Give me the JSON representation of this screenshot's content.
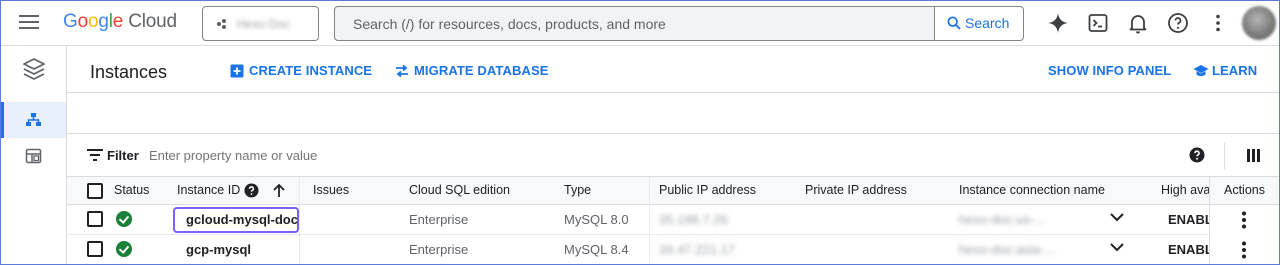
{
  "topbar": {
    "brand": {
      "google": "Google",
      "cloud": "Cloud"
    },
    "project_name": "Hexo Doc",
    "search": {
      "placeholder": "Search (/) for resources, docs, products, and more",
      "button_label": "Search"
    },
    "icons": [
      "gemini-sparkle-icon",
      "cloud-shell-icon",
      "notifications-icon",
      "help-icon",
      "more-vert-icon"
    ]
  },
  "rail": {
    "product_icon": "sql-stack-icon",
    "items": [
      {
        "name": "instances-nav-icon",
        "active": true
      },
      {
        "name": "overview-nav-icon",
        "active": false
      }
    ]
  },
  "header": {
    "title": "Instances",
    "create_label": "CREATE INSTANCE",
    "migrate_label": "MIGRATE DATABASE",
    "info_panel_label": "SHOW INFO PANEL",
    "learn_label": "LEARN"
  },
  "filter": {
    "label": "Filter",
    "placeholder": "Enter property name or value"
  },
  "table": {
    "columns": {
      "status": "Status",
      "instance_id": "Instance ID",
      "issues": "Issues",
      "edition": "Cloud SQL edition",
      "type": "Type",
      "public_ip": "Public IP address",
      "private_ip": "Private IP address",
      "connection": "Instance connection name",
      "ha": "High avai",
      "actions": "Actions"
    },
    "rows": [
      {
        "instance_id": "gcloud-mysql-doc",
        "issues": "",
        "edition": "Enterprise",
        "type": "MySQL 8.0",
        "public_ip": "35.198.7.26",
        "private_ip": "",
        "connection": "hexo-doc:us-...",
        "ha": "ENABL"
      },
      {
        "instance_id": "gcp-mysql",
        "issues": "",
        "edition": "Enterprise",
        "type": "MySQL 8.4",
        "public_ip": "34.47.221.17",
        "private_ip": "",
        "connection": "hexo-doc:asia-...",
        "ha": "ENABL"
      }
    ]
  },
  "colors": {
    "accent": "#1a73e8",
    "status_ok": "#188038",
    "focus_ring": "#7b61ff"
  }
}
